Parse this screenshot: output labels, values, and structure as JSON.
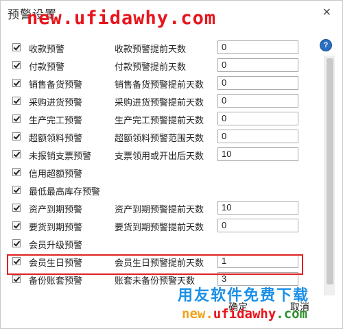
{
  "dialog": {
    "title": "预警设置",
    "close_glyph": "✕",
    "help_glyph": "?",
    "ok_label": "确定",
    "cancel_label": "取消"
  },
  "rows": [
    {
      "label": "收款预警",
      "sublabel": "收款预警提前天数",
      "value": "0",
      "checked": true
    },
    {
      "label": "付款预警",
      "sublabel": "付款预警提前天数",
      "value": "0",
      "checked": true
    },
    {
      "label": "销售备货预警",
      "sublabel": "销售备货预警提前天数",
      "value": "0",
      "checked": true
    },
    {
      "label": "采购进货预警",
      "sublabel": "采购进货预警提前天数",
      "value": "0",
      "checked": true
    },
    {
      "label": "生产完工预警",
      "sublabel": "生产完工预警提前天数",
      "value": "0",
      "checked": true
    },
    {
      "label": "超额领料预警",
      "sublabel": "超额领料预警范围天数",
      "value": "0",
      "checked": true
    },
    {
      "label": "未报销支票预警",
      "sublabel": "支票领用或开出后天数",
      "value": "10",
      "checked": true
    },
    {
      "label": "信用超额预警",
      "sublabel": "",
      "value": null,
      "checked": true
    },
    {
      "label": "最低最高库存预警",
      "sublabel": "",
      "value": null,
      "checked": true
    },
    {
      "label": "资产到期预警",
      "sublabel": "资产到期预警提前天数",
      "value": "10",
      "checked": true
    },
    {
      "label": "要货到期预警",
      "sublabel": "要货到期预警提前天数",
      "value": "0",
      "checked": true
    },
    {
      "label": "会员升级预警",
      "sublabel": "",
      "value": null,
      "checked": true
    },
    {
      "label": "会员生日预警",
      "sublabel": "会员生日预警提前天数",
      "value": "1",
      "checked": true
    },
    {
      "label": "备份账套预警",
      "sublabel": "账套未备份预警天数",
      "value": "3",
      "checked": true
    }
  ],
  "watermark": {
    "top_url": "new.ufidawhy.com",
    "brand_cn": "用友软件免费下载",
    "url_part1": "new.",
    "url_part2": "ufidawhy",
    "url_part3": ".com"
  },
  "colors": {
    "highlight_border": "#e02020",
    "help_icon": "#2c6fc1",
    "watermark_red": "#e8141c",
    "watermark_blue": "#1a8fe8"
  }
}
